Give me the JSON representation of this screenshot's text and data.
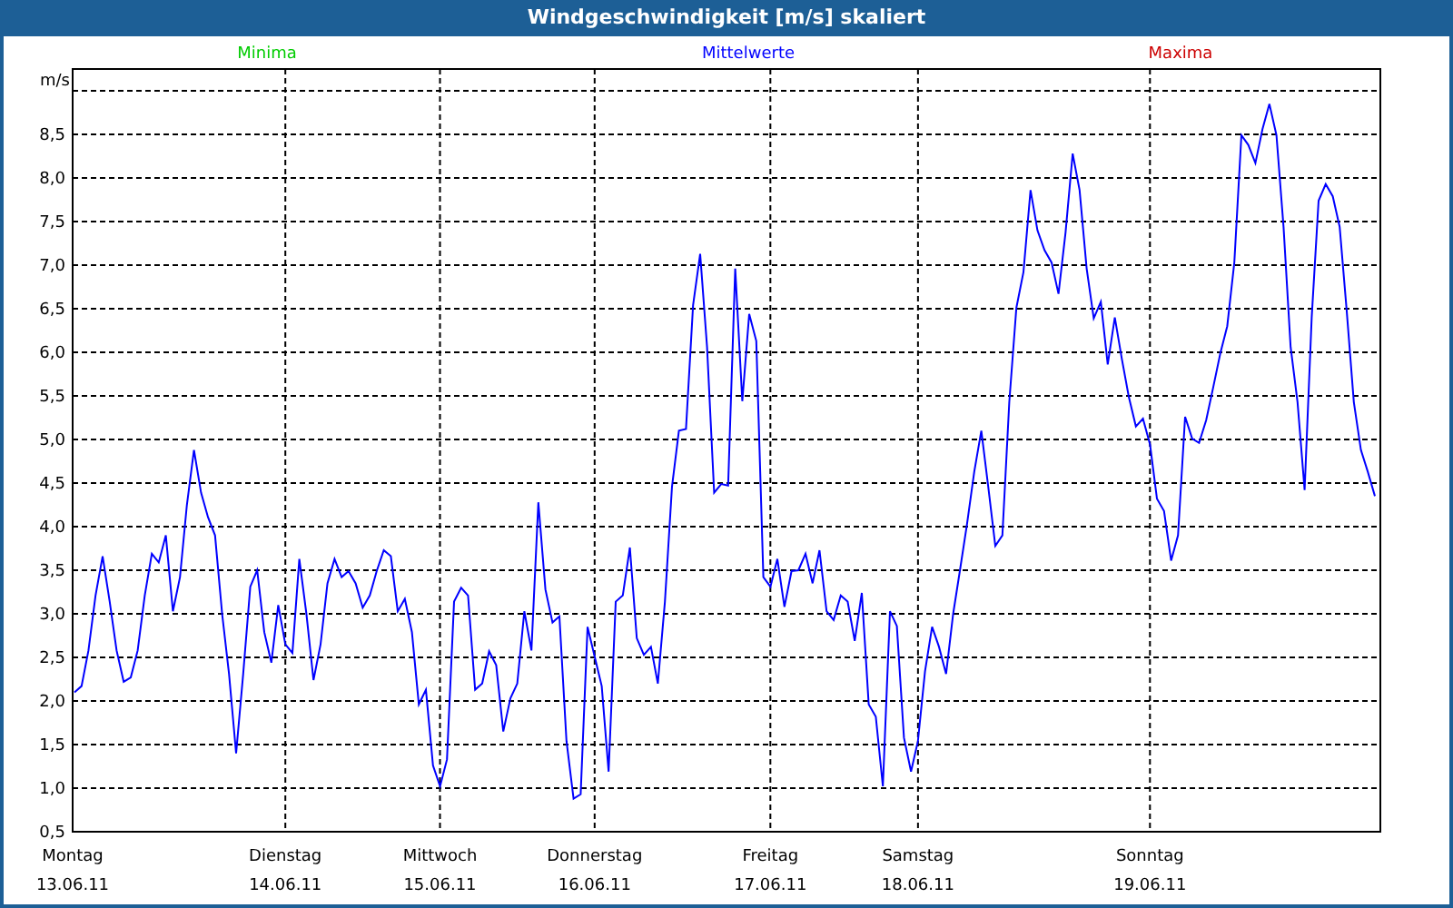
{
  "window": {
    "title": "Windgeschwindigkeit [m/s] skaliert"
  },
  "chart": {
    "legend": [
      {
        "label": "Minima",
        "color": "#00cc00"
      },
      {
        "label": "Maxima",
        "color": "#cc0000"
      }
    ],
    "xtick_dates": [
      "13.06.11",
      "14.06.11",
      "15.06.11",
      "16.06.11",
      "17.06.11",
      "18.06.11",
      "19.06.11"
    ],
    "chart_data": {
      "type": "line",
      "grid": true,
      "ylabel": "m/s",
      "ylim": [
        0.5,
        9.25
      ],
      "categories": [
        "Montag",
        null,
        null,
        null,
        null,
        null,
        null,
        null,
        null,
        null,
        null,
        null,
        null,
        null,
        null,
        null,
        null,
        null,
        null,
        null,
        null,
        null,
        null,
        null,
        null,
        null,
        null,
        null,
        null,
        null,
        "Dienstag",
        null,
        null,
        null,
        null,
        null,
        null,
        null,
        null,
        null,
        null,
        null,
        null,
        null,
        null,
        null,
        null,
        null,
        null,
        null,
        null,
        null,
        "Mittwoch",
        null,
        null,
        null,
        null,
        null,
        null,
        null,
        null,
        null,
        null,
        null,
        null,
        null,
        null,
        null,
        null,
        null,
        null,
        null,
        null,
        null,
        "Donnerstag",
        null,
        null,
        null,
        null,
        null,
        null,
        null,
        null,
        null,
        null,
        null,
        null,
        null,
        null,
        null,
        null,
        null,
        null,
        null,
        null,
        null,
        null,
        null,
        null,
        "Freitag",
        null,
        null,
        null,
        null,
        null,
        null,
        null,
        null,
        null,
        null,
        null,
        null,
        null,
        null,
        null,
        null,
        null,
        null,
        null,
        null,
        "Samstag",
        null,
        null,
        null,
        null,
        null,
        null,
        null,
        null,
        null,
        null,
        null,
        null,
        null,
        null,
        null,
        null,
        null,
        null,
        null,
        null,
        null,
        null,
        null,
        null,
        null,
        null,
        null,
        null,
        null,
        null,
        null,
        null,
        "Sonntag",
        null,
        null,
        null,
        null,
        null,
        null,
        null,
        null,
        null,
        null,
        null,
        null,
        null,
        null,
        null,
        null,
        null,
        null,
        null,
        null,
        null,
        null,
        null,
        null,
        null,
        null,
        null,
        null,
        null,
        null,
        null,
        null
      ],
      "yticks": [
        {
          "value": 0.5,
          "label": "0,5"
        },
        {
          "value": 1,
          "label": "1,0"
        },
        {
          "value": 1.5,
          "label": "1,5"
        },
        {
          "value": 2,
          "label": "2,0"
        },
        {
          "value": 2.5,
          "label": "2,5"
        },
        {
          "value": 3,
          "label": "3,0"
        },
        {
          "value": 3.5,
          "label": "3,5"
        },
        {
          "value": 4,
          "label": "4,0"
        },
        {
          "value": 4.5,
          "label": "4,5"
        },
        {
          "value": 5,
          "label": "5,0"
        },
        {
          "value": 5.5,
          "label": "5,5"
        },
        {
          "value": 6,
          "label": "6,0"
        },
        {
          "value": 6.5,
          "label": "6,5"
        },
        {
          "value": 7,
          "label": "7,0"
        },
        {
          "value": 7.5,
          "label": "7,5"
        },
        {
          "value": 8,
          "label": "8,0"
        },
        {
          "value": 8.5,
          "label": "8,5"
        }
      ],
      "series": [
        {
          "name": "Mittelwerte",
          "color": "#0000ff",
          "values": [
            2.1,
            2.17,
            2.58,
            3.21,
            3.66,
            3.14,
            2.58,
            2.22,
            2.27,
            2.58,
            3.21,
            3.69,
            3.59,
            3.9,
            3.03,
            3.42,
            4.25,
            4.88,
            4.39,
            4.11,
            3.9,
            3.0,
            2.31,
            1.4,
            2.31,
            3.31,
            3.5,
            2.79,
            2.44,
            3.1,
            2.65,
            2.55,
            3.63,
            3.0,
            2.24,
            2.65,
            3.35,
            3.63,
            3.42,
            3.49,
            3.35,
            3.07,
            3.21,
            3.49,
            3.73,
            3.66,
            3.03,
            3.17,
            2.79,
            1.96,
            2.13,
            1.26,
            1.02,
            1.33,
            3.14,
            3.3,
            3.21,
            2.13,
            2.2,
            2.57,
            2.41,
            1.65,
            2.03,
            2.2,
            3.03,
            2.58,
            4.28,
            3.28,
            2.9,
            2.97,
            1.54,
            0.88,
            0.93,
            2.85,
            2.51,
            2.17,
            1.19,
            3.14,
            3.21,
            3.76,
            2.72,
            2.53,
            2.62,
            2.2,
            3.14,
            4.46,
            5.1,
            5.12,
            6.54,
            7.13,
            6.06,
            4.39,
            4.49,
            4.47,
            6.96,
            5.44,
            6.44,
            6.13,
            3.42,
            3.31,
            3.63,
            3.08,
            3.49,
            3.5,
            3.69,
            3.35,
            3.73,
            3.03,
            2.93,
            3.21,
            3.14,
            2.69,
            3.24,
            1.96,
            1.82,
            1.02,
            3.03,
            2.86,
            1.58,
            1.19,
            1.54,
            2.34,
            2.85,
            2.62,
            2.31,
            3.0,
            3.52,
            4.04,
            4.63,
            5.1,
            4.46,
            3.78,
            3.9,
            5.43,
            6.51,
            6.92,
            7.86,
            7.4,
            7.17,
            7.03,
            6.67,
            7.38,
            8.28,
            7.86,
            6.96,
            6.39,
            6.58,
            5.86,
            6.4,
            5.92,
            5.49,
            5.15,
            5.24,
            4.94,
            4.32,
            4.18,
            3.61,
            3.9,
            5.26,
            5.01,
            4.96,
            5.22,
            5.6,
            5.99,
            6.3,
            7.03,
            8.49,
            8.38,
            8.17,
            8.56,
            8.85,
            8.49,
            7.44,
            6.06,
            5.43,
            4.42,
            6.4,
            7.74,
            7.93,
            7.79,
            7.44,
            6.47,
            5.43,
            4.88,
            4.63,
            4.35
          ]
        }
      ]
    }
  }
}
